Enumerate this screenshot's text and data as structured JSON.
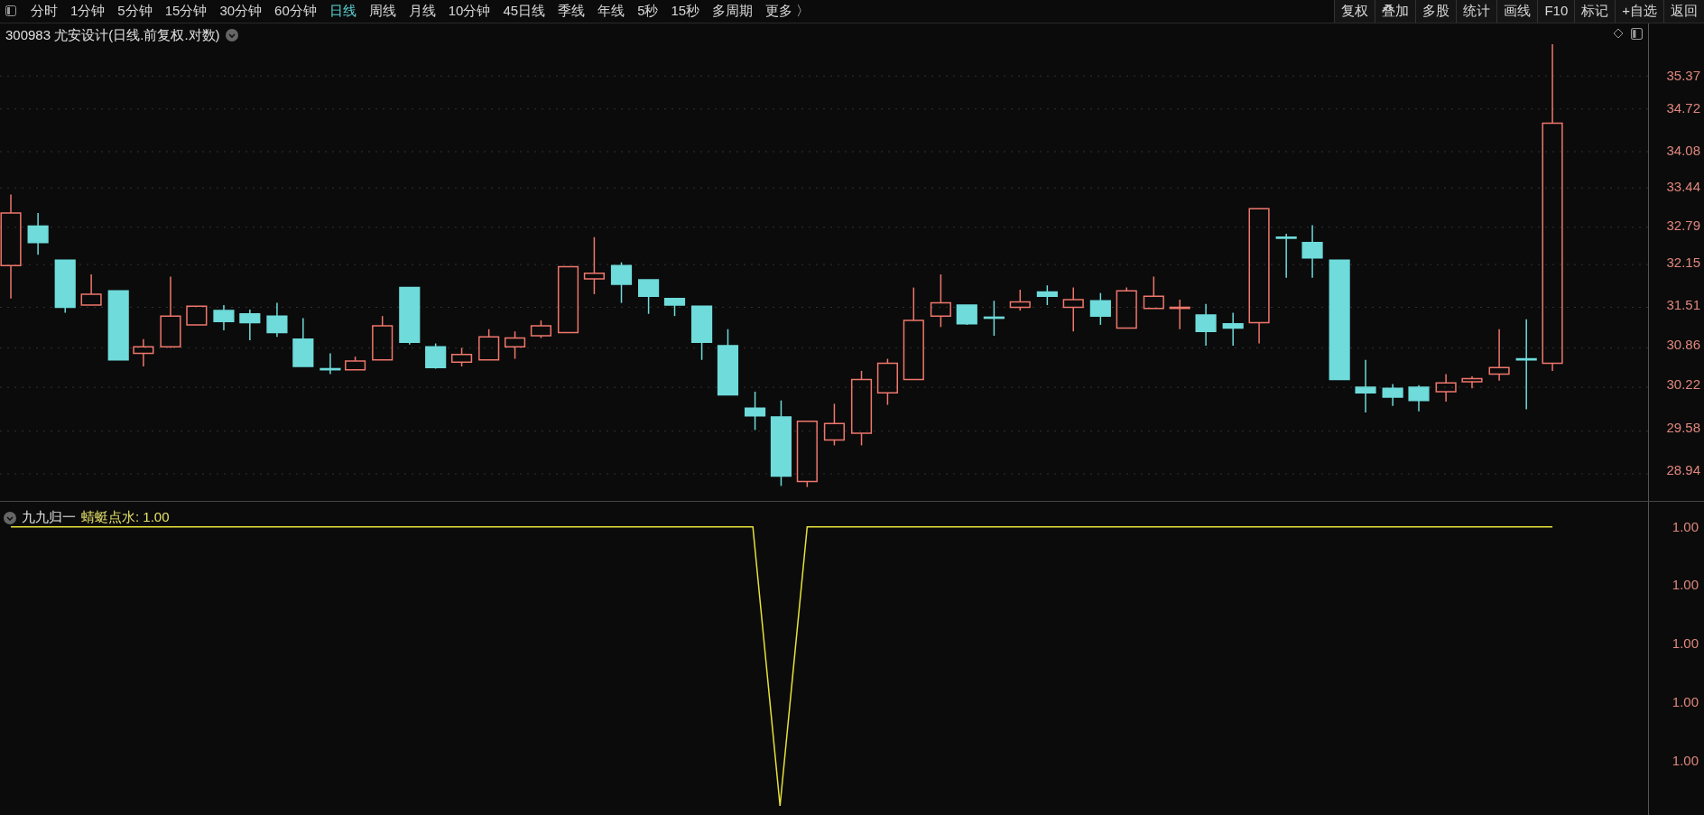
{
  "toolbar": {
    "periods": [
      {
        "label": "分时",
        "selected": false
      },
      {
        "label": "1分钟",
        "selected": false
      },
      {
        "label": "5分钟",
        "selected": false
      },
      {
        "label": "15分钟",
        "selected": false
      },
      {
        "label": "30分钟",
        "selected": false
      },
      {
        "label": "60分钟",
        "selected": false
      },
      {
        "label": "日线",
        "selected": true
      },
      {
        "label": "周线",
        "selected": false
      },
      {
        "label": "月线",
        "selected": false
      },
      {
        "label": "10分钟",
        "selected": false
      },
      {
        "label": "45日线",
        "selected": false
      },
      {
        "label": "季线",
        "selected": false
      },
      {
        "label": "年线",
        "selected": false
      },
      {
        "label": "5秒",
        "selected": false
      },
      {
        "label": "15秒",
        "selected": false
      },
      {
        "label": "多周期",
        "selected": false
      },
      {
        "label": "更多 〉",
        "selected": false
      }
    ],
    "tools": [
      "复权",
      "叠加",
      "多股",
      "统计",
      "画线",
      "F10",
      "标记",
      "+自选",
      "返回"
    ]
  },
  "price_chart": {
    "title": "300983 尤安设计(日线.前复权.对数)",
    "axis_labels": [
      "35.37",
      "34.72",
      "34.08",
      "33.44",
      "32.79",
      "32.15",
      "31.51",
      "30.86",
      "30.22",
      "29.58",
      "28.94"
    ]
  },
  "indicator": {
    "name": "九九归一",
    "legend": "蜻蜓点水: 1.00",
    "axis_labels": [
      "1.00",
      "1.00",
      "1.00",
      "1.00",
      "1.00"
    ]
  }
}
